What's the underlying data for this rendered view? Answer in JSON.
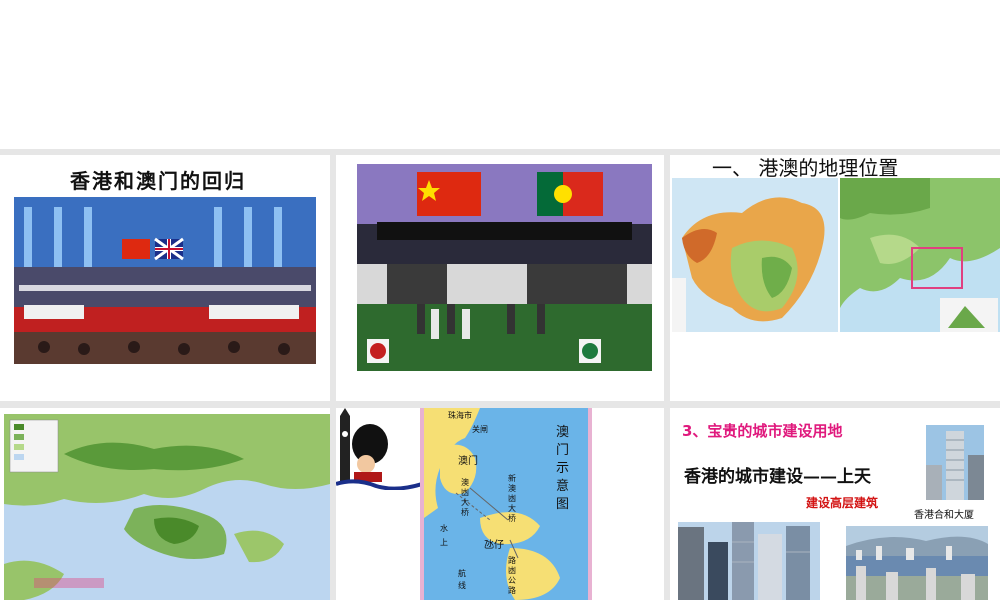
{
  "slide1": {
    "title": "香港和澳门的回归"
  },
  "slide3": {
    "heading": "一、    港澳的地理位置"
  },
  "slide5": {
    "map_title": "澳门示意图",
    "labels": {
      "zhuhai": "珠海市",
      "guanzha": "关闸",
      "macau": "澳门",
      "taipa": "氹仔",
      "bridge1": "澳凼大桥",
      "bridge2": "新澳凼大桥",
      "water": "水上",
      "route": "航线",
      "road": "路凼公路"
    }
  },
  "slide6": {
    "section": "3、宝贵的城市建设用地",
    "title": "香港的城市建设——上天",
    "subtitle": "建设高层建筑",
    "caption": "香港合和大厦"
  },
  "colors": {
    "band": "#e6e6e6",
    "magenta": "#e0197d",
    "red": "#d31414"
  }
}
